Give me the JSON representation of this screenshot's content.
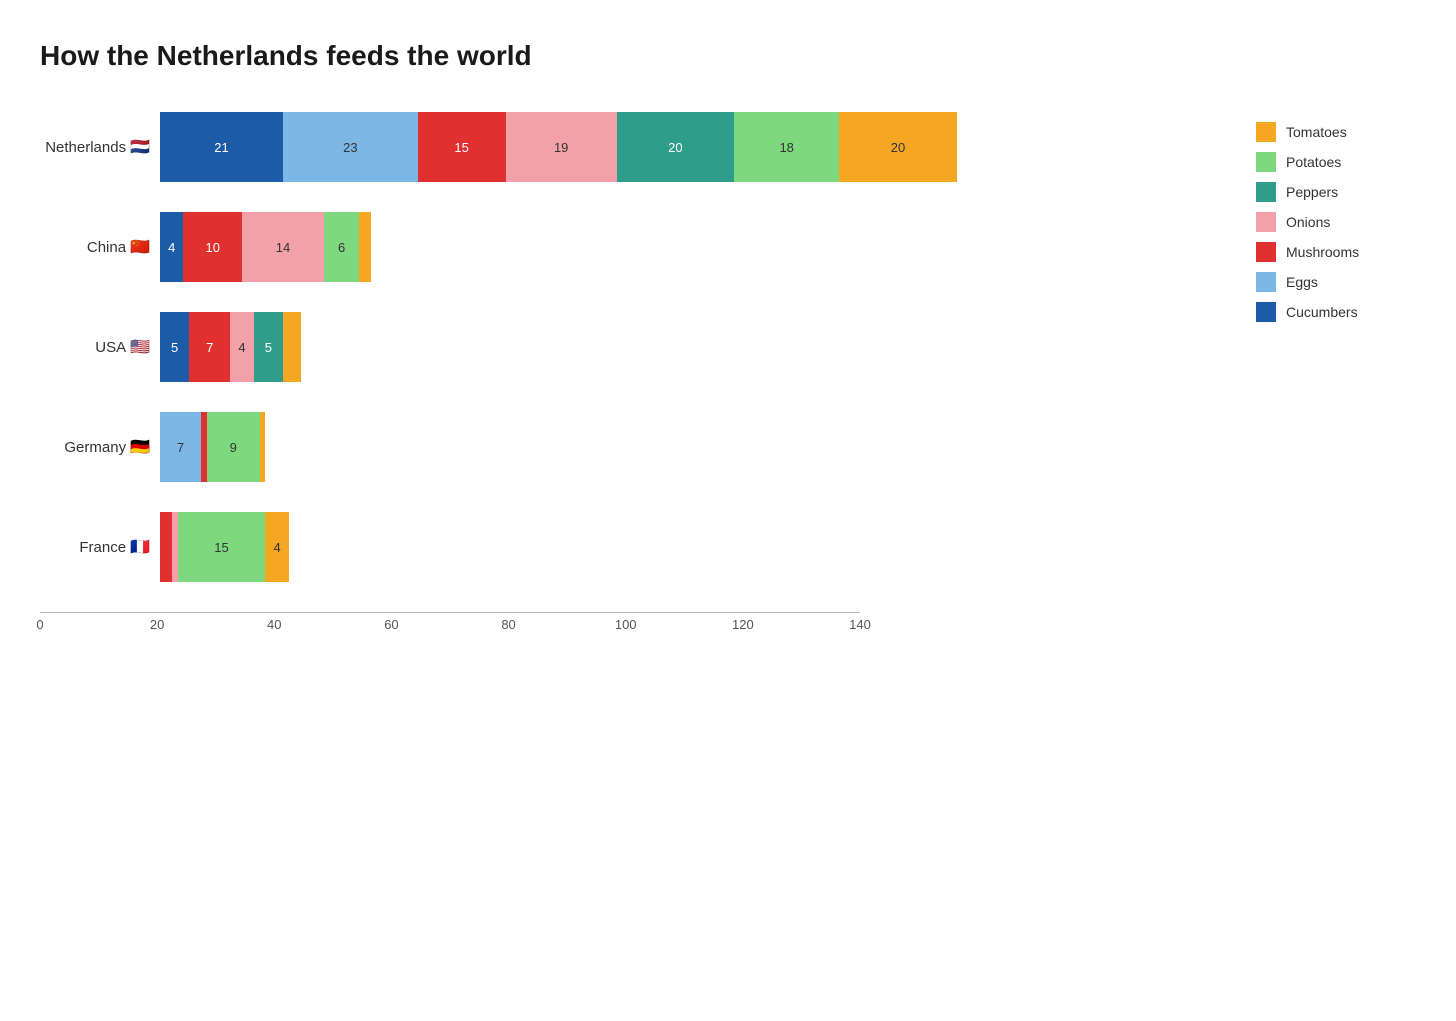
{
  "title": "How the Netherlands feeds the world",
  "colors": {
    "tomatoes": "#F5A623",
    "potatoes": "#7ED87F",
    "peppers": "#2E9E8A",
    "onions": "#F4A0A8",
    "mushrooms": "#E03030",
    "eggs": "#7BB8E8",
    "cucumbers": "#1C5BA8"
  },
  "legend": [
    {
      "label": "Tomatoes",
      "color_key": "tomatoes"
    },
    {
      "label": "Potatoes",
      "color_key": "potatoes"
    },
    {
      "label": "Peppers",
      "color_key": "peppers"
    },
    {
      "label": "Onions",
      "color_key": "onions"
    },
    {
      "label": "Mushrooms",
      "color_key": "mushrooms"
    },
    {
      "label": "Eggs",
      "color_key": "eggs"
    },
    {
      "label": "Cucumbers",
      "color_key": "cucumbers"
    }
  ],
  "x_axis": {
    "max": 140,
    "ticks": [
      0,
      20,
      40,
      60,
      80,
      100,
      120,
      140
    ]
  },
  "countries": [
    {
      "name": "Netherlands",
      "flag": "🇳🇱",
      "segments": [
        {
          "category": "cucumbers",
          "value": 21
        },
        {
          "category": "eggs",
          "value": 23
        },
        {
          "category": "mushrooms",
          "value": 15
        },
        {
          "category": "onions",
          "value": 19
        },
        {
          "category": "peppers",
          "value": 20
        },
        {
          "category": "potatoes",
          "value": 18
        },
        {
          "category": "tomatoes",
          "value": 20
        }
      ]
    },
    {
      "name": "China",
      "flag": "🇨🇳",
      "segments": [
        {
          "category": "cucumbers",
          "value": 4
        },
        {
          "category": "mushrooms",
          "value": 10
        },
        {
          "category": "onions",
          "value": 14
        },
        {
          "category": "potatoes",
          "value": 6
        },
        {
          "category": "tomatoes",
          "value": 2
        }
      ]
    },
    {
      "name": "USA",
      "flag": "🇺🇸",
      "segments": [
        {
          "category": "cucumbers",
          "value": 5
        },
        {
          "category": "mushrooms",
          "value": 7
        },
        {
          "category": "onions",
          "value": 4
        },
        {
          "category": "peppers",
          "value": 5
        },
        {
          "category": "tomatoes",
          "value": 3
        }
      ]
    },
    {
      "name": "Germany",
      "flag": "🇩🇪",
      "segments": [
        {
          "category": "eggs",
          "value": 7
        },
        {
          "category": "mushrooms",
          "value": 1
        },
        {
          "category": "potatoes",
          "value": 9
        },
        {
          "category": "tomatoes",
          "value": 1
        }
      ]
    },
    {
      "name": "France",
      "flag": "🇫🇷",
      "segments": [
        {
          "category": "mushrooms",
          "value": 2
        },
        {
          "category": "onions",
          "value": 1
        },
        {
          "category": "potatoes",
          "value": 15
        },
        {
          "category": "tomatoes",
          "value": 4
        }
      ]
    }
  ]
}
